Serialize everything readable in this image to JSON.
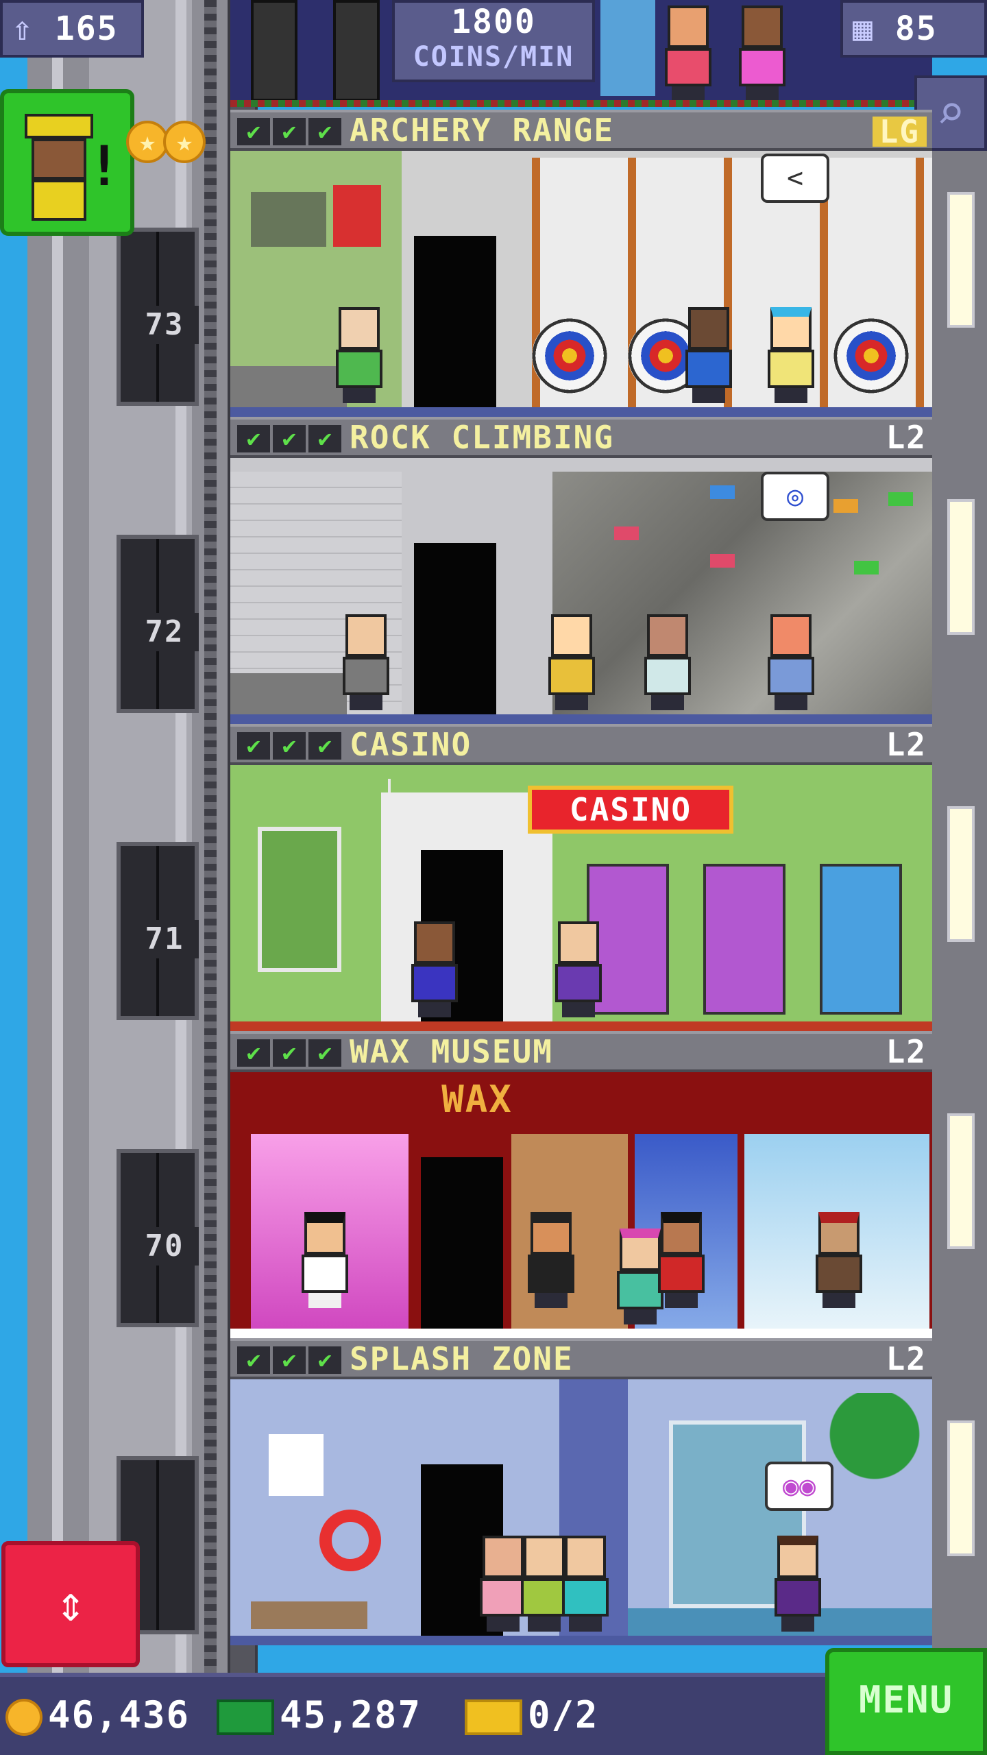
{
  "hud": {
    "population": "165",
    "floors_count": "85",
    "coins_per_min_value": "1800",
    "coins_per_min_unit": "COINS/MIN"
  },
  "floors": [
    {
      "name": "ARCHERY RANGE",
      "level": "LG",
      "checks": [
        "✔",
        "✔",
        "✔"
      ]
    },
    {
      "name": "ROCK CLIMBING",
      "level": "L2",
      "checks": [
        "✔",
        "✔",
        "✔"
      ]
    },
    {
      "name": "CASINO",
      "level": "L2",
      "checks": [
        "✔",
        "✔",
        "✔"
      ],
      "sign": "CASINO"
    },
    {
      "name": "WAX MUSEUM",
      "level": "L2",
      "checks": [
        "✔",
        "✔",
        "✔"
      ],
      "sign": "WAX"
    },
    {
      "name": "SPLASH ZONE",
      "level": "L2",
      "checks": [
        "✔",
        "✔",
        "✔"
      ]
    }
  ],
  "elevator_floor_numbers": [
    "73",
    "72",
    "71",
    "70"
  ],
  "bubbles": [
    "<"
  ],
  "bottom": {
    "coins": "46,436",
    "bux": "45,287",
    "tickets": "0/2",
    "menu": "MENU"
  },
  "icons": {
    "population": "person-up-icon",
    "floors": "building-icon",
    "search": "magnifier-icon",
    "coin": "coin-icon",
    "bux": "bux-icon",
    "ticket": "golden-ticket-icon",
    "elevator": "up-down-arrows-icon",
    "star": "star-coin-icon"
  },
  "colors": {
    "sky": "#2fa7e6",
    "floor_label_text": "#f4f0a0",
    "check_green": "#5ee04a",
    "menu_green": "#2fc42a",
    "elevator_red": "#ec2346"
  }
}
